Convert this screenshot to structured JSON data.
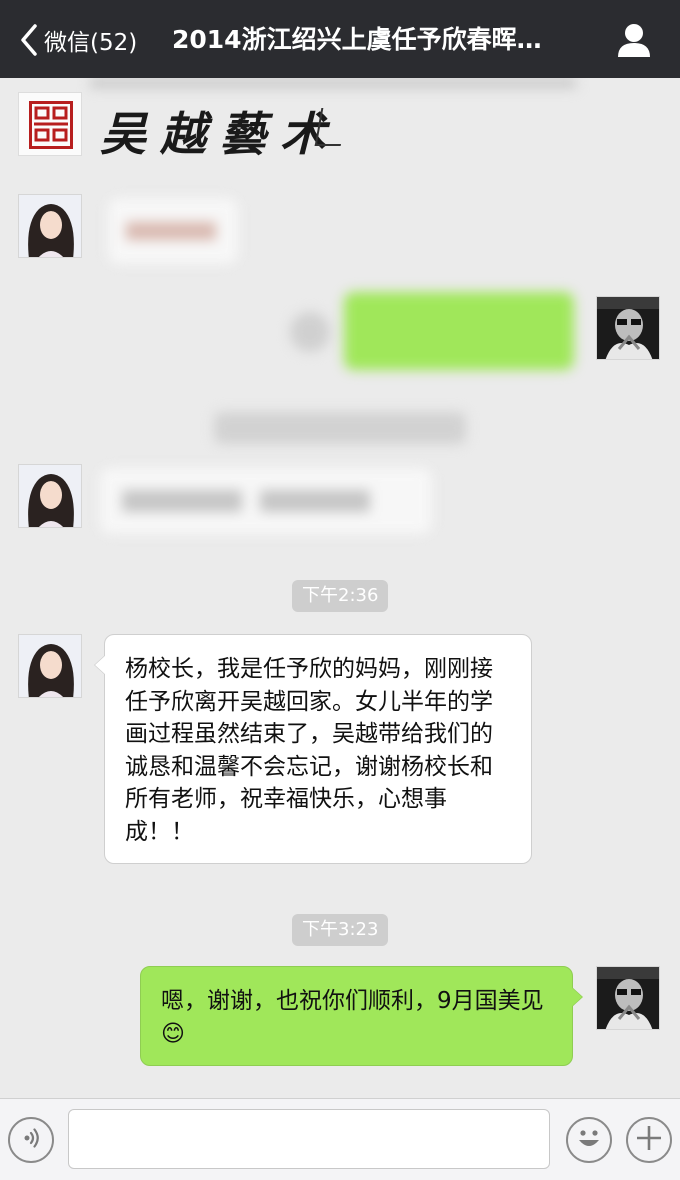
{
  "navbar": {
    "back_label": "微信(52)",
    "title": "2014浙江绍兴上虞任予欣春晖…"
  },
  "messages": {
    "calligraphy": "吴越藝术",
    "timestamp_1": "下午2:36",
    "incoming_text": "杨校长，我是任予欣的妈妈，刚刚接任予欣离开吴越回家。女儿半年的学画过程虽然结束了，吴越带给我们的诚恳和温馨不会忘记，谢谢杨校长和所有老师，祝幸福快乐，心想事成！！",
    "timestamp_2": "下午3:23",
    "outgoing_text": "嗯，谢谢，也祝你们顺利，9月国美见",
    "outgoing_emoji": "😊"
  },
  "input": {
    "placeholder": ""
  },
  "colors": {
    "navbar_bg": "#2b2c30",
    "chat_bg": "#ebebeb",
    "outgoing_bubble": "#a0e75a",
    "timestamp_bg": "#cecece"
  },
  "icons": {
    "back": "chevron-left-icon",
    "profile": "person-icon",
    "voice": "voice-icon",
    "emoji": "smiley-icon",
    "more": "plus-icon"
  }
}
